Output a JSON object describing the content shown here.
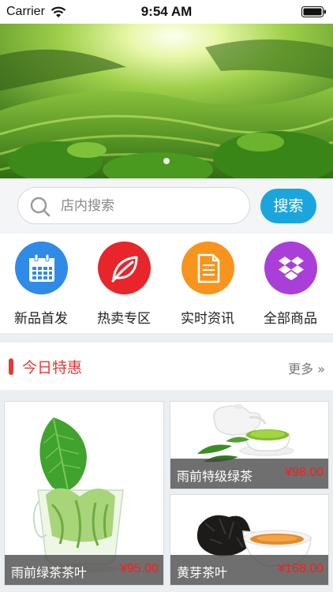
{
  "status_bar": {
    "carrier": "Carrier",
    "time": "9:54 AM"
  },
  "banner": {
    "image": "tea-plantation-hills",
    "slide_count": 1,
    "active_slide": 1
  },
  "search": {
    "placeholder": "店内搜索",
    "button_label": "搜索",
    "accent_color": "#1aa6dc"
  },
  "categories": [
    {
      "label": "新品首发",
      "icon": "calendar-icon",
      "color": "#2f8be6"
    },
    {
      "label": "热卖专区",
      "icon": "leaf-icon",
      "color": "#e8252a"
    },
    {
      "label": "实时资讯",
      "icon": "document-icon",
      "color": "#f7941d"
    },
    {
      "label": "全部商品",
      "icon": "dropbox-icon",
      "color": "#a93fd8"
    }
  ],
  "section": {
    "title": "今日特惠",
    "more": "更多 »",
    "accent_color": "#e53935"
  },
  "products": [
    {
      "name": "雨前绿茶茶叶",
      "price": "¥95.00",
      "image": "green-tea-glass"
    },
    {
      "name": "雨前特级绿茶",
      "price": "¥98.00",
      "image": "teapot-and-cup"
    },
    {
      "name": "黄芽茶叶",
      "price": "¥168.00",
      "image": "dark-tea-leaves-and-cup"
    }
  ]
}
